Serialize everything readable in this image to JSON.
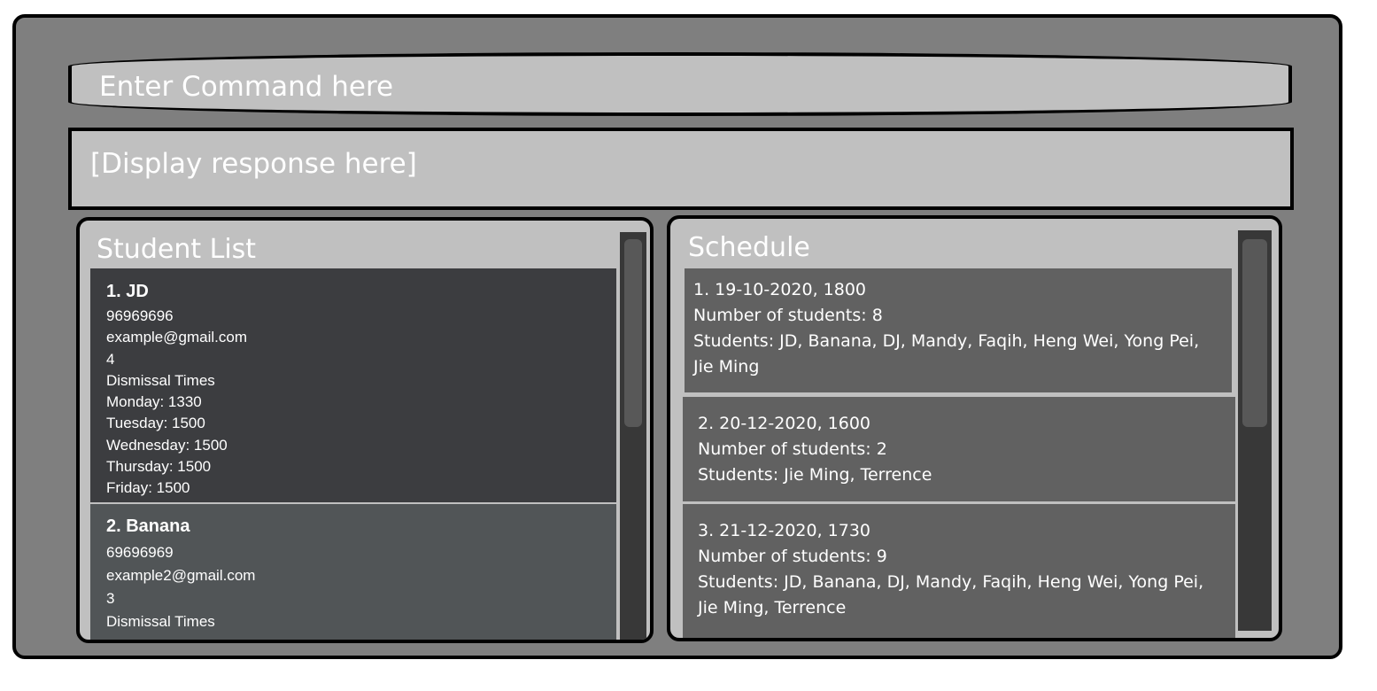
{
  "command": {
    "placeholder": "Enter Command here"
  },
  "response": {
    "text": "[Display response here]"
  },
  "student_list": {
    "title": "Student List",
    "students": [
      {
        "index_name": "1.  JD",
        "phone": "96969696",
        "email": "example@gmail.com",
        "count": "4",
        "dismissal_header": "Dismissal Times",
        "monday": "Monday: 1330",
        "tuesday": "Tuesday: 1500",
        "wednesday": "Wednesday: 1500",
        "thursday": "Thursday: 1500",
        "friday": "Friday: 1500"
      },
      {
        "index_name": "2.  Banana",
        "phone": "69696969",
        "email": "example2@gmail.com",
        "count": "3",
        "dismissal_header": "Dismissal Times"
      }
    ]
  },
  "schedule": {
    "title": "Schedule",
    "entries": [
      {
        "header": "1. 19-10-2020, 1800",
        "count": "Number of students: 8",
        "students_line1": "Students: JD, Banana, DJ, Mandy, Faqih, Heng Wei, Yong Pei,",
        "students_line2": "Jie Ming"
      },
      {
        "header": "2. 20-12-2020, 1600",
        "count": "Number of students: 2",
        "students_line1": "Students: Jie Ming, Terrence"
      },
      {
        "header": "3. 21-12-2020, 1730",
        "count": "Number of students: 9",
        "students_line1": "Students: JD, Banana, DJ, Mandy, Faqih, Heng Wei, Yong Pei,",
        "students_line2": "Jie Ming, Terrence"
      }
    ]
  }
}
